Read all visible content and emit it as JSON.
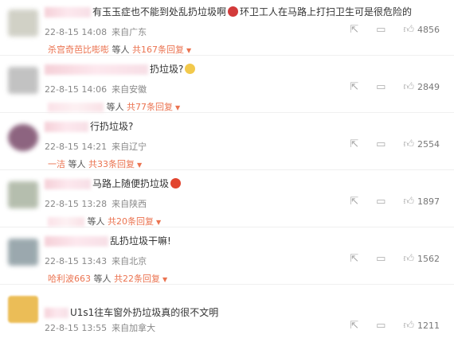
{
  "comments": [
    {
      "text": "有玉玉症也不能到处乱扔垃圾啊",
      "text2": "环卫工人在马路上打扫卫生可是很危险的",
      "time": "22-8-15 14:08",
      "location": "来自广东",
      "likes": "4856",
      "reply_user": "杀宫奇芭比嘭嘭",
      "reply_mid": "等人",
      "reply_count": "共167条回复",
      "avatar_color": "#c9c9bd"
    },
    {
      "text": "扔垃圾?",
      "text2": "",
      "time": "22-8-15 14:06",
      "location": "来自安徽",
      "likes": "2849",
      "reply_user": "",
      "reply_mid": "等人",
      "reply_count": "共77条回复",
      "avatar_color": "#b8b8b8"
    },
    {
      "text": "行扔垃圾?",
      "text2": "",
      "time": "22-8-15 14:21",
      "location": "来自辽宁",
      "likes": "2554",
      "reply_user": "一洁",
      "reply_mid": "等人",
      "reply_count": "共33条回复",
      "avatar_color": "#7a4a6a"
    },
    {
      "text": "马路上随便扔垃圾",
      "text2": "",
      "time": "22-8-15 13:28",
      "location": "来自陕西",
      "likes": "1897",
      "reply_user": "",
      "reply_mid": "等人",
      "reply_count": "共20条回复",
      "avatar_color": "#a9b3a0"
    },
    {
      "text": "乱扔垃圾干嘛!",
      "text2": "",
      "time": "22-8-15 13:43",
      "location": "来自北京",
      "likes": "1562",
      "reply_user": "哈利波663",
      "reply_mid": "等人",
      "reply_count": "共22条回复",
      "avatar_color": "#8a9aa0"
    },
    {
      "text": "U1s1往车窗外扔垃圾真的很不文明",
      "text2": "",
      "time": "22-8-15 13:55",
      "location": "来自加拿大",
      "likes": "1211",
      "reply_user": "",
      "reply_mid": "",
      "reply_count": "",
      "avatar_color": "#e8b23a"
    }
  ],
  "icons": {
    "share": "share-icon",
    "comment": "comment-icon",
    "like": "thumbs-up-icon",
    "caret": "caret-down-icon"
  },
  "colors": {
    "accent": "#eb7350",
    "meta": "#888888"
  }
}
